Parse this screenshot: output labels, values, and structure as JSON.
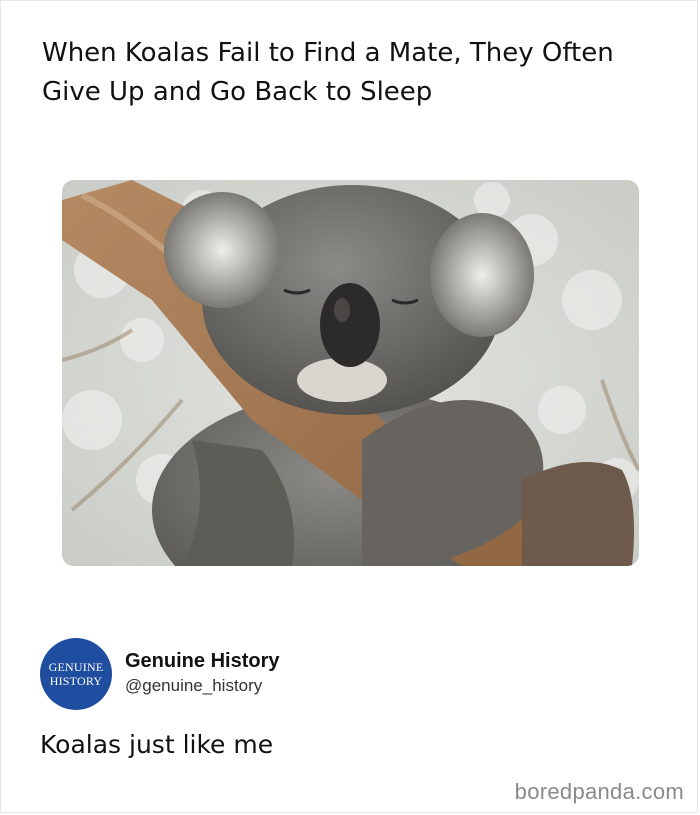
{
  "headline": {
    "line_1": "When Koalas Fail to Find a Mate, They Often",
    "line_2": "Give Up and Go Back to Sleep"
  },
  "photo": {
    "subject": "koala-sleeping-on-branch"
  },
  "profile": {
    "avatar_line_1": "GENUINE",
    "avatar_line_2": "HISTORY",
    "avatar_color": "#1f4ea1",
    "display_name": "Genuine History",
    "handle": "@genuine_history"
  },
  "post": {
    "text": "Koalas just like me"
  },
  "watermark": {
    "text": "boredpanda.com"
  }
}
